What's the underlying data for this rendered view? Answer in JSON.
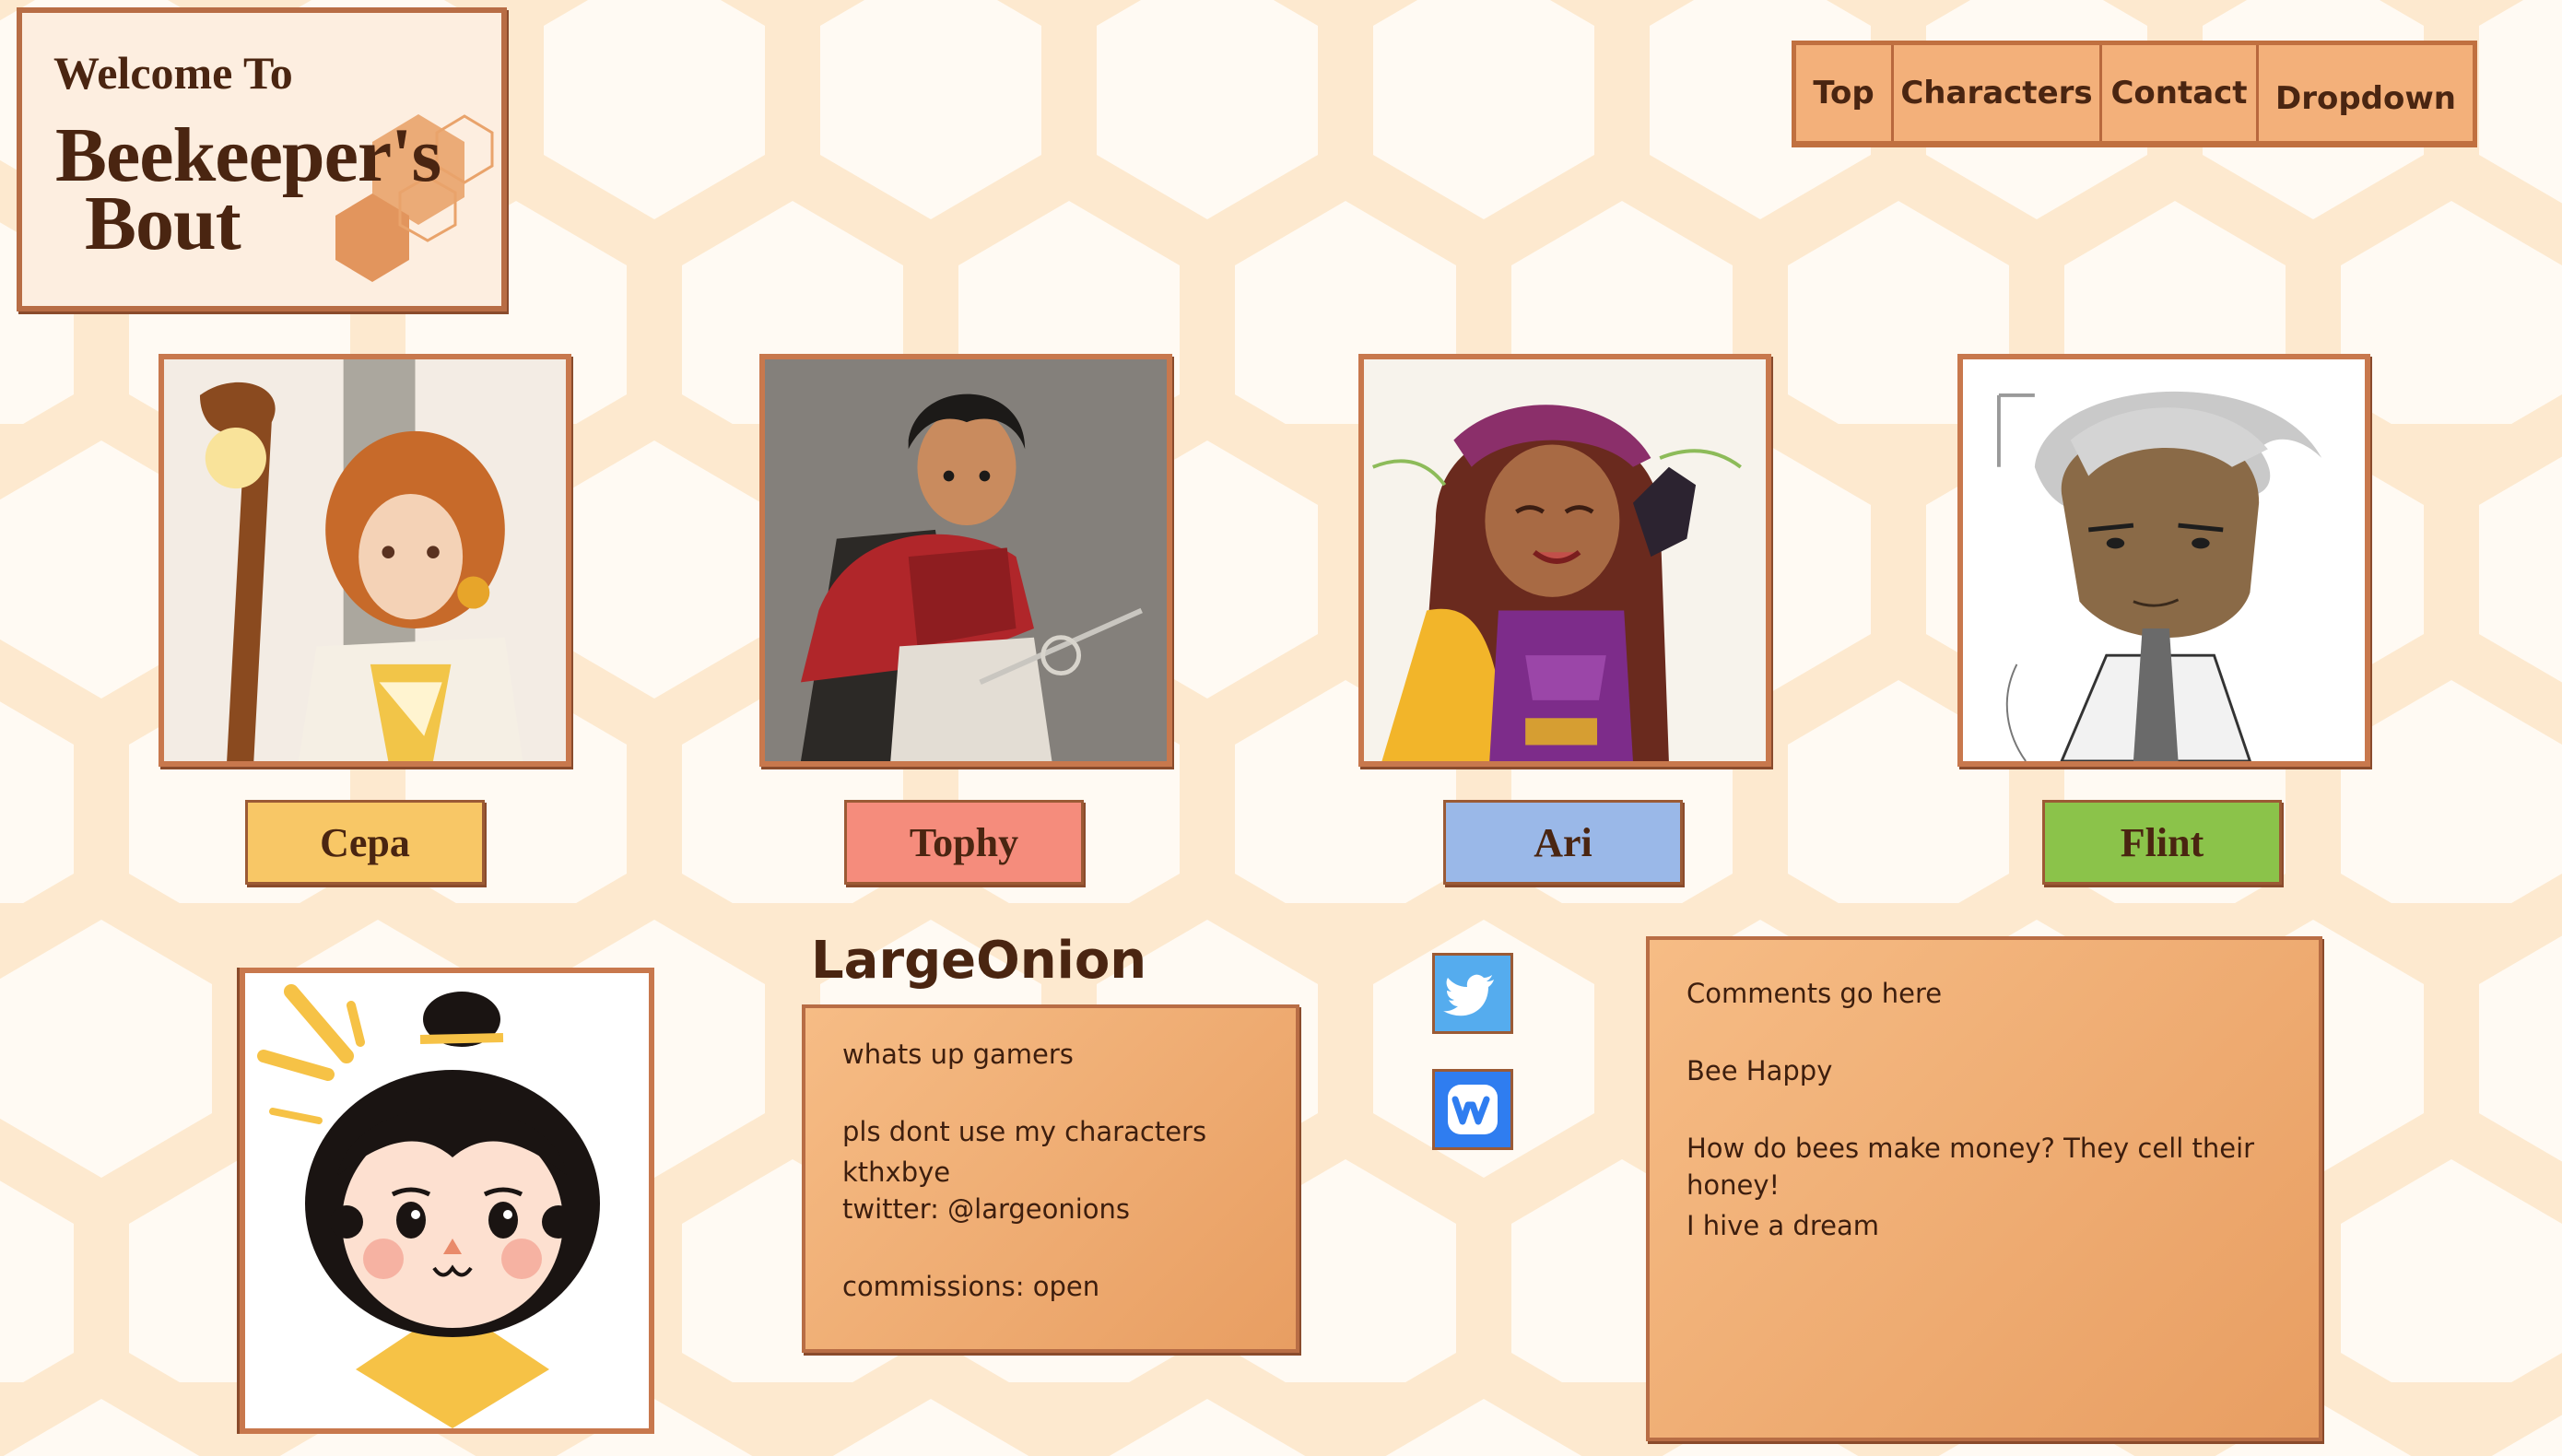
{
  "header": {
    "welcome": "Welcome To",
    "title_line1": "Beekeeper's",
    "title_line2": "Bout"
  },
  "nav": {
    "items": [
      "Top",
      "Characters",
      "Contact",
      "Dropdown"
    ]
  },
  "characters": [
    {
      "name": "Cepa",
      "color": "#f8c766"
    },
    {
      "name": "Tophy",
      "color": "#f58c7c"
    },
    {
      "name": "Ari",
      "color": "#9ab8e8"
    },
    {
      "name": "Flint",
      "color": "#8bc34a"
    }
  ],
  "profile": {
    "username": "LargeOnion",
    "lines": [
      "whats up gamers",
      "pls dont use my characters kthxbye",
      "twitter: @largeonions",
      "commissions: open"
    ]
  },
  "social": [
    {
      "icon": "twitter-icon",
      "color": "#55acee"
    },
    {
      "icon": "weebly-icon",
      "color": "#2f7df0"
    }
  ],
  "comments": {
    "lines": [
      "Comments go here",
      "Bee Happy",
      "How do bees make money? They cell their honey!",
      "I hive a dream"
    ]
  }
}
